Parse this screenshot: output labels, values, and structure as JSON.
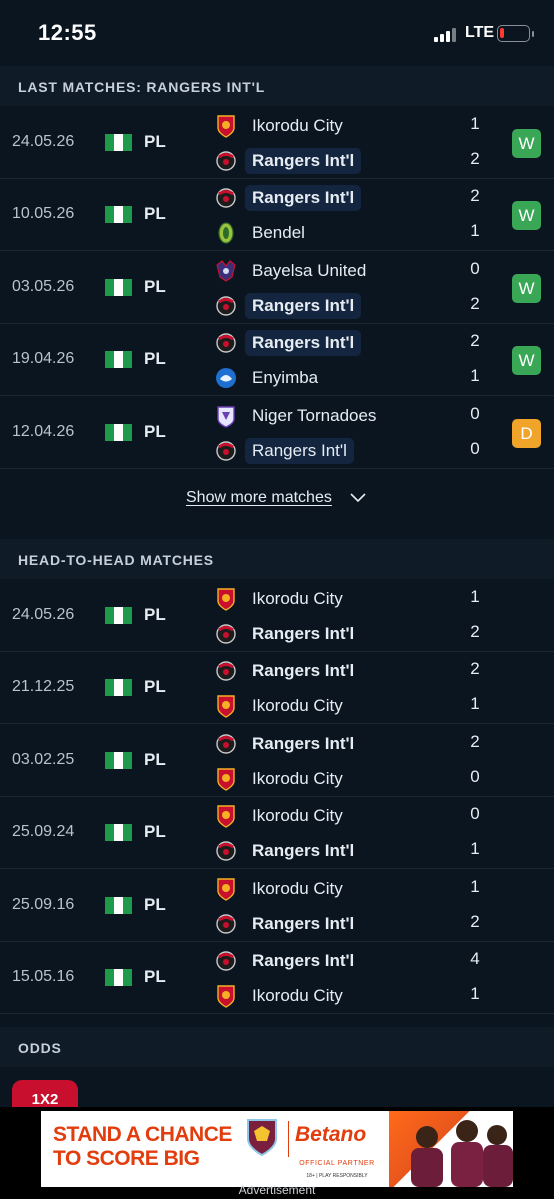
{
  "status_bar": {
    "time": "12:55",
    "network": "LTE"
  },
  "colors": {
    "background": "#0a1520",
    "header": "#0f1b27",
    "win": "#3aa757",
    "draw": "#f0a52a",
    "odds_tab": "#c8102e",
    "ad_brand": "#e33d0d"
  },
  "last_matches": {
    "title": "LAST MATCHES: RANGERS INT'L",
    "show_more": "Show more matches",
    "rows": [
      {
        "date": "24.05.26",
        "league": "PL",
        "home": "Ikorodu City",
        "home_crest": "ikorodu-crest",
        "home_score": "1",
        "away": "Rangers Int'l",
        "away_crest": "rangers-crest",
        "away_score": "2",
        "result": "W"
      },
      {
        "date": "10.05.26",
        "league": "PL",
        "home": "Rangers Int'l",
        "home_crest": "rangers-crest",
        "home_score": "2",
        "away": "Bendel",
        "away_crest": "bendel-crest",
        "away_score": "1",
        "result": "W"
      },
      {
        "date": "03.05.26",
        "league": "PL",
        "home": "Bayelsa United",
        "home_crest": "bayelsa-crest",
        "home_score": "0",
        "away": "Rangers Int'l",
        "away_crest": "rangers-crest",
        "away_score": "2",
        "result": "W"
      },
      {
        "date": "19.04.26",
        "league": "PL",
        "home": "Rangers Int'l",
        "home_crest": "rangers-crest",
        "home_score": "2",
        "away": "Enyimba",
        "away_crest": "enyimba-crest",
        "away_score": "1",
        "result": "W"
      },
      {
        "date": "12.04.26",
        "league": "PL",
        "home": "Niger Tornadoes",
        "home_crest": "niger-crest",
        "home_score": "0",
        "away": "Rangers Int'l",
        "away_crest": "rangers-crest",
        "away_score": "0",
        "result": "D"
      }
    ]
  },
  "head_to_head": {
    "title": "HEAD-TO-HEAD MATCHES",
    "rows": [
      {
        "date": "24.05.26",
        "league": "PL",
        "home": "Ikorodu City",
        "home_crest": "ikorodu-crest",
        "home_score": "1",
        "away": "Rangers Int'l",
        "away_crest": "rangers-crest",
        "away_score": "2"
      },
      {
        "date": "21.12.25",
        "league": "PL",
        "home": "Rangers Int'l",
        "home_crest": "rangers-crest",
        "home_score": "2",
        "away": "Ikorodu City",
        "away_crest": "ikorodu-crest",
        "away_score": "1"
      },
      {
        "date": "03.02.25",
        "league": "PL",
        "home": "Rangers Int'l",
        "home_crest": "rangers-crest",
        "home_score": "2",
        "away": "Ikorodu City",
        "away_crest": "ikorodu-crest",
        "away_score": "0"
      },
      {
        "date": "25.09.24",
        "league": "PL",
        "home": "Ikorodu City",
        "home_crest": "ikorodu-crest",
        "home_score": "0",
        "away": "Rangers Int'l",
        "away_crest": "rangers-crest",
        "away_score": "1"
      },
      {
        "date": "25.09.16",
        "league": "PL",
        "home": "Ikorodu City",
        "home_crest": "ikorodu-crest",
        "home_score": "1",
        "away": "Rangers Int'l",
        "away_crest": "rangers-crest",
        "away_score": "2"
      },
      {
        "date": "15.05.16",
        "league": "PL",
        "home": "Rangers Int'l",
        "home_crest": "rangers-crest",
        "home_score": "4",
        "away": "Ikorodu City",
        "away_crest": "ikorodu-crest",
        "away_score": "1"
      }
    ]
  },
  "odds": {
    "title": "ODDS",
    "tab": "1X2"
  },
  "ad": {
    "headline": "STAND A CHANCE TO SCORE BIG",
    "brand": "Betano",
    "partner": "OFFICIAL PARTNER",
    "disclaimer": "18+ | PLAY RESPONSIBLY",
    "label": "Advertisement"
  }
}
